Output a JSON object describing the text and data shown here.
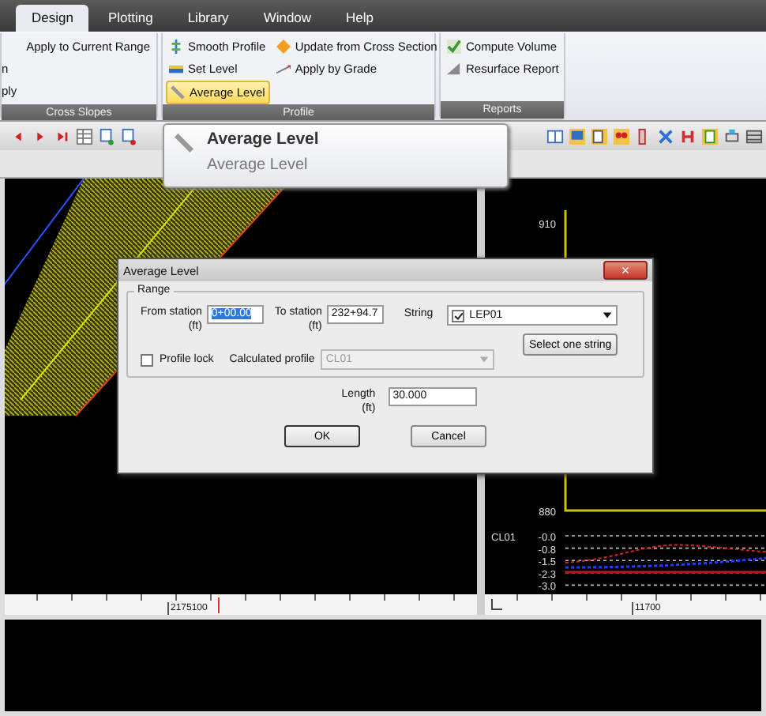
{
  "tabs": [
    {
      "label": "Design",
      "selected": true
    },
    {
      "label": "Plotting",
      "selected": false
    },
    {
      "label": "Library",
      "selected": false
    },
    {
      "label": "Window",
      "selected": false
    },
    {
      "label": "Help",
      "selected": false
    }
  ],
  "ribbon": {
    "groups": [
      {
        "label": "Cross Slopes",
        "items": [
          {
            "label": "Apply to Current Range",
            "selected": false
          },
          {
            "label": "n",
            "selected": false
          },
          {
            "label": "ply",
            "selected": false
          }
        ]
      },
      {
        "label": "Profile",
        "items": [
          {
            "label": "Smooth Profile",
            "selected": false
          },
          {
            "label": "Set Level",
            "selected": false
          },
          {
            "label": "Average Level",
            "selected": true
          },
          {
            "label": "Update from Cross Section",
            "selected": false
          },
          {
            "label": "Apply by Grade",
            "selected": false
          }
        ]
      },
      {
        "label": "Reports",
        "items": [
          {
            "label": "Compute Volume",
            "selected": false
          },
          {
            "label": "Resurface Report",
            "selected": false
          }
        ]
      }
    ]
  },
  "tooltip": {
    "title": "Average Level",
    "description": "Average Level"
  },
  "profile_view": {
    "elevations": [
      "910",
      "880"
    ],
    "profile_name": "CL01",
    "offsets": [
      "-0.0",
      "-0.8",
      "-1.5",
      "-2.3",
      "-3.0"
    ]
  },
  "rulers": {
    "plan": "2175100",
    "profile": "11700"
  },
  "dialog": {
    "title": "Average Level",
    "close": "×",
    "group": "Range",
    "from_station": {
      "label": "From station",
      "unit": "(ft)",
      "value": "0+00.00"
    },
    "to_station": {
      "label": "To station",
      "unit": "(ft)",
      "value": "232+94.7"
    },
    "string": {
      "label": "String",
      "checked": true,
      "value": "LEP01"
    },
    "select_button": "Select one string",
    "profile_lock": {
      "label": "Profile lock",
      "checked": false
    },
    "calculated_profile": {
      "label": "Calculated profile",
      "value": "CL01",
      "disabled": true
    },
    "length": {
      "label": "Length",
      "unit": "(ft)",
      "value": "30.000"
    },
    "buttons": [
      "OK",
      "Cancel"
    ]
  }
}
